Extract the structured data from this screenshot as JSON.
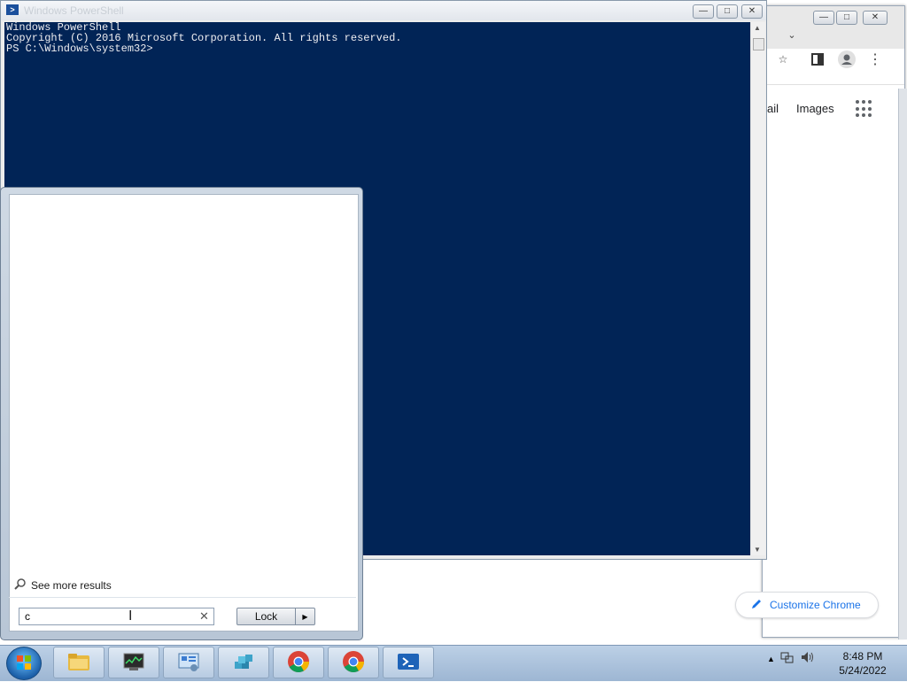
{
  "chrome": {
    "links": [
      "ail",
      "Images"
    ],
    "customize_label": "Customize Chrome"
  },
  "powershell": {
    "title": "Windows PowerShell",
    "lines": [
      "Windows PowerShell",
      "Copyright (C) 2016 Microsoft Corporation. All rights reserved.",
      "",
      "PS C:\\Windows\\system32>"
    ]
  },
  "start_menu": {
    "see_more": "See more results",
    "search_value": "c",
    "lock_label": "Lock"
  },
  "taskbar": {
    "clock_time": "8:48 PM",
    "clock_date": "5/24/2022",
    "apps": [
      "file-explorer",
      "task-manager",
      "control-panel",
      "registry-editor",
      "chrome",
      "chrome",
      "powershell"
    ]
  },
  "colors": {
    "console_bg": "#012456",
    "accent": "#1a73e8"
  }
}
